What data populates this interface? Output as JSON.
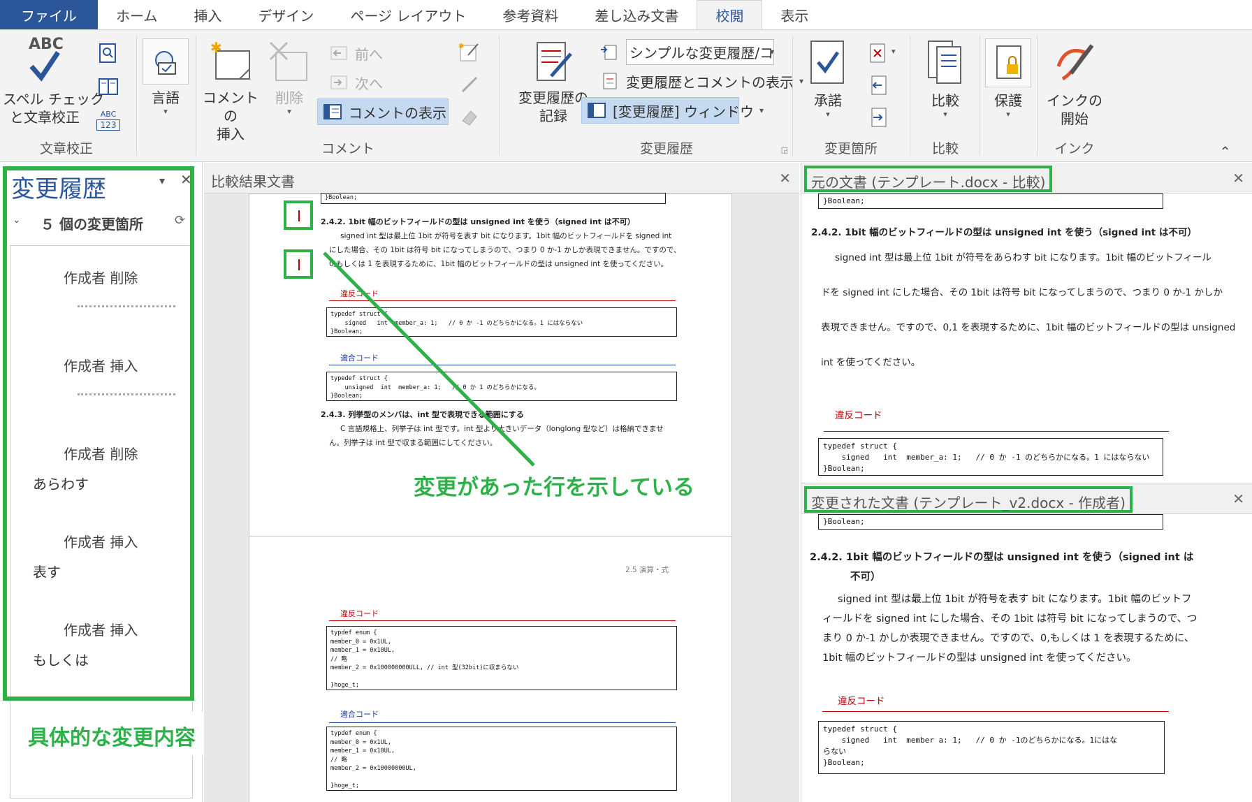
{
  "tabs": {
    "file": "ファイル",
    "home": "ホーム",
    "insert": "挿入",
    "design": "デザイン",
    "layout": "ページ レイアウト",
    "references": "参考資料",
    "mailings": "差し込み文書",
    "review": "校閲",
    "view": "表示"
  },
  "ribbon": {
    "spell_abc": "ABC",
    "spell_line1": "スペル チェック",
    "spell_line2": "と文章校正",
    "abc123_top": "ABC",
    "abc123_bottom": "123",
    "proofing_label": "文章校正",
    "language_label": "言語",
    "new_comment_line1": "コメントの",
    "new_comment_line2": "挿入",
    "delete_label": "削除",
    "prev_label": "前へ",
    "next_label": "次へ",
    "show_comments_label": "コメントの表示",
    "comments_group_label": "コメント",
    "track_line1": "変更履歴の",
    "track_line2": "記録",
    "markup_select": "シンプルな変更履歴/コ…",
    "show_markup_label": "変更履歴とコメントの表示",
    "reviewing_pane_label": "[変更履歴] ウィンドウ",
    "tracking_group_label": "変更履歴",
    "accept_label": "承諾",
    "changes_group_label": "変更箇所",
    "compare_label": "比較",
    "compare_group_label": "比較",
    "protect_label": "保護",
    "ink_line1": "インクの",
    "ink_line2": "開始",
    "ink_group_label": "インク"
  },
  "revisions": {
    "title": "変更履歴",
    "summary": "５ 個の変更箇所",
    "items": [
      {
        "header": "作成者  削除",
        "text": ""
      },
      {
        "header": "作成者  挿入",
        "text": ""
      },
      {
        "header": "作成者  削除",
        "text": "あらわす"
      },
      {
        "header": "作成者  挿入",
        "text": "表す"
      },
      {
        "header": "作成者  挿入",
        "text": "もしくは"
      }
    ]
  },
  "annotations": {
    "left_note": "具体的な変更内容",
    "arrow_note": "変更があった行を示している"
  },
  "compare": {
    "title": "比較結果文書",
    "code_top": "}Boolean;",
    "h242": "2.4.2.  1bit 幅のビットフィールドの型は unsigned int を使う（signed int は不可）",
    "p1": "signed int 型は最上位 1bit が符号を表す bit になります。1bit 幅のビットフィールドを signed int",
    "p2": "にした場合、その 1bit は符号 bit になってしまうので、つまり 0 か-1 かしか表現できません。ですので、",
    "p3": "0,もしくは 1 を表現するために、1bit 幅のビットフィールドの型は unsigned int を使ってください。",
    "violation": "違反コード",
    "code_viol": "typedef struct {\n    signed   int  member_a: 1;   // 0 か -1 のどちらかになる。1 にはならない\n}Boolean;",
    "compliant": "適合コード",
    "code_comp": "typedef struct {\n    unsigned  int  member_a: 1;   // 0 か 1 のどちらかになる。\n}Boolean;",
    "h243": "2.4.3.  列挙型のメンバは、int 型で表現できる範囲にする",
    "q1": "C 言語規格上、列挙子は int 型です。int 型より大きいデータ（longlong 型など）は格納できませ",
    "q2": "ん。列挙子は int 型で収まる範囲にしてください。",
    "page2_header": "2.5 演算・式",
    "violation2": "違反コード",
    "code_enum1": "typdef enum {\nmember_0 = 0x1UL,\nmember_1 = 0x10UL,\n// 略\nmember_2 = 0x100000000ULL, // int 型(32bit)に収まらない\n\n}hoge_t;",
    "compliant2": "適合コード",
    "code_enum2": "typdef enum {\nmember_0 = 0x1UL,\nmember_1 = 0x10UL,\n// 略\nmember_2 = 0x10000000UL,\n\n}hoge_t;"
  },
  "original": {
    "title": "元の文書 (テンプレート.docx - 比較)",
    "code_top": "}Boolean;",
    "h": "2.4.2.   1bit 幅のビットフィールドの型は unsigned int を使う（signed int は不可）",
    "l1": "signed  int 型は最上位 1bit が符号をあらわす bit になります。1bit 幅のビットフィール",
    "l2": "ドを signed int にした場合、その 1bit は符号 bit になってしまうので、つまり 0 か-1 かしか",
    "l3": "表現できません。ですので、0,1 を表現するために、1bit 幅のビットフィールドの型は unsigned",
    "l4": "int を使ってください。",
    "violation": "違反コード",
    "code": "typedef struct {\n    signed   int  member_a: 1;   // 0 か -1 のどちらかになる。1 にはならない\n}Boolean;"
  },
  "modified": {
    "title": "変更された文書 (テンプレート_v2.docx - 作成者)",
    "code_top": "}Boolean;",
    "h1": "2.4.2.   1bit 幅のビットフィールドの型は unsigned int を使う（signed int は",
    "h2": "不可）",
    "l1": "signed  int 型は最上位 1bit が符号を表す bit になります。1bit 幅のビットフ",
    "l2": "ィールドを signed int にした場合、その 1bit は符号 bit になってしまうので、つ",
    "l3": "まり 0 か-1 かしか表現できません。ですので、0,もしくは 1 を表現するために、",
    "l4": "1bit 幅のビットフィールドの型は unsigned int を使ってください。",
    "violation": "違反コード",
    "code": "typedef struct {\n    signed   int  member a: 1;   // 0 か -1のどちらかになる。1にはな\nらない\n}Boolean;"
  },
  "colors": {
    "brand": "#2b579a",
    "annotation": "#2fb14a",
    "violation": "#c00000",
    "compliant": "#1f3a93"
  }
}
